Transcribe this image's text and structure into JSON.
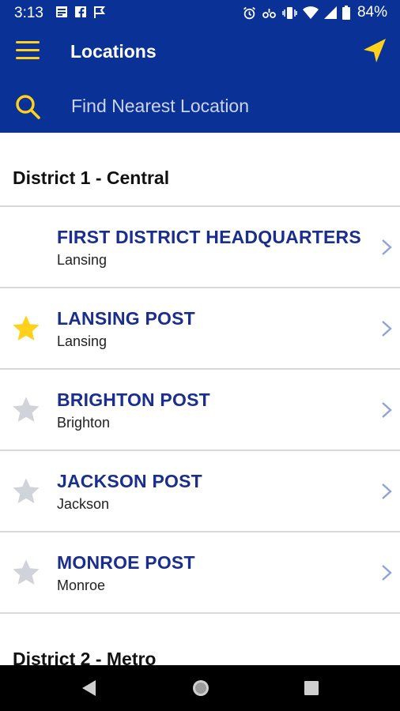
{
  "status": {
    "time": "3:13",
    "battery": "84%"
  },
  "appbar": {
    "title": "Locations"
  },
  "search": {
    "placeholder": "Find Nearest Location",
    "value": ""
  },
  "districts": [
    {
      "name": "District 1 - Central",
      "locations": [
        {
          "title": "FIRST DISTRICT HEADQUARTERS",
          "city": "Lansing",
          "star": "none"
        },
        {
          "title": "LANSING POST",
          "city": "Lansing",
          "star": "filled"
        },
        {
          "title": "BRIGHTON POST",
          "city": "Brighton",
          "star": "empty"
        },
        {
          "title": "JACKSON POST",
          "city": "Jackson",
          "star": "empty"
        },
        {
          "title": "MONROE POST",
          "city": "Monroe",
          "star": "empty"
        }
      ]
    },
    {
      "name": "District 2 - Metro",
      "locations": []
    }
  ],
  "colors": {
    "primary": "#0a3296",
    "accent": "#ffd11a",
    "title_text": "#1a2e8e",
    "star_empty": "#d0d3da",
    "chevron": "#8fa3d6"
  },
  "icons": {
    "menu": "menu-icon",
    "navigate": "navigation-arrow-icon",
    "search": "search-icon",
    "chevron": "chevron-right-icon",
    "star": "star-icon"
  }
}
